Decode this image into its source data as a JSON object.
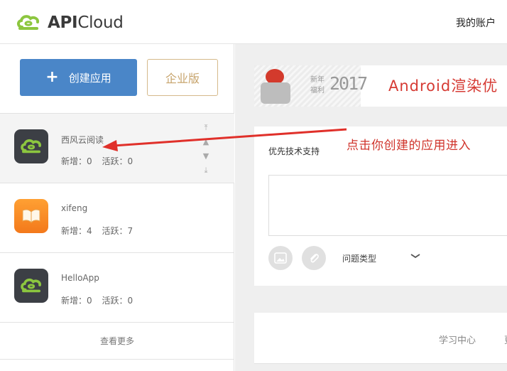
{
  "header": {
    "logo_text_bold": "API",
    "logo_text": "Cloud",
    "account_link": "我的账户"
  },
  "sidebar": {
    "create_button": "创建应用",
    "enterprise_button": "企业版",
    "apps": [
      {
        "name": "西风云阅读",
        "new_label": "新增：0",
        "active_label": "活跃：0",
        "icon": "apicloud-logo-icon",
        "selected": true
      },
      {
        "name": "xifeng",
        "new_label": "新增：4",
        "active_label": "活跃：7",
        "icon": "book-icon",
        "selected": false
      },
      {
        "name": "HelloApp",
        "new_label": "新增：0",
        "active_label": "活跃：0",
        "icon": "apicloud-logo-icon",
        "selected": false
      }
    ],
    "view_more": "查看更多"
  },
  "main": {
    "banner": {
      "small_line1": "新年",
      "small_line2": "福利",
      "year": "2017",
      "title": "Android渲染优"
    },
    "support": {
      "title": "优先技术支持",
      "issue_type": "问题类型"
    },
    "bottom": {
      "learn_center": "学习中心",
      "clipped": "更"
    }
  },
  "annotation": {
    "text": "点击你创建的应用进入"
  },
  "colors": {
    "brand_green": "#8cc63f",
    "primary_blue": "#4a86c8",
    "enterprise_gold": "#c7a46c",
    "annotation_red": "#d0342c"
  }
}
